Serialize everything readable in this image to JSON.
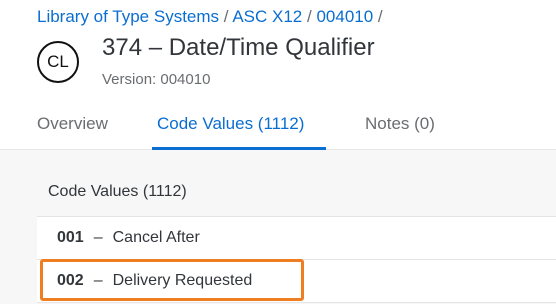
{
  "breadcrumb": {
    "items": [
      "Library of Type Systems",
      "ASC X12",
      "004010"
    ],
    "separator": "/"
  },
  "header": {
    "avatar_initials": "CL",
    "title": "374 – Date/Time Qualifier",
    "version": "Version: 004010"
  },
  "tabs": [
    {
      "label": "Overview",
      "active": false
    },
    {
      "label": "Code Values (1112)",
      "active": true
    },
    {
      "label": "Notes (0)",
      "active": false
    }
  ],
  "section": {
    "title": "Code Values (1112)"
  },
  "code_values": [
    {
      "code": "001",
      "dash": "–",
      "description": "Cancel After"
    },
    {
      "code": "002",
      "dash": "–",
      "description": "Delivery Requested",
      "highlighted": true
    }
  ],
  "colors": {
    "accent": "#0a6ed1",
    "highlight": "#ef7d22",
    "text": "#32363a",
    "muted": "#6a6d70"
  }
}
